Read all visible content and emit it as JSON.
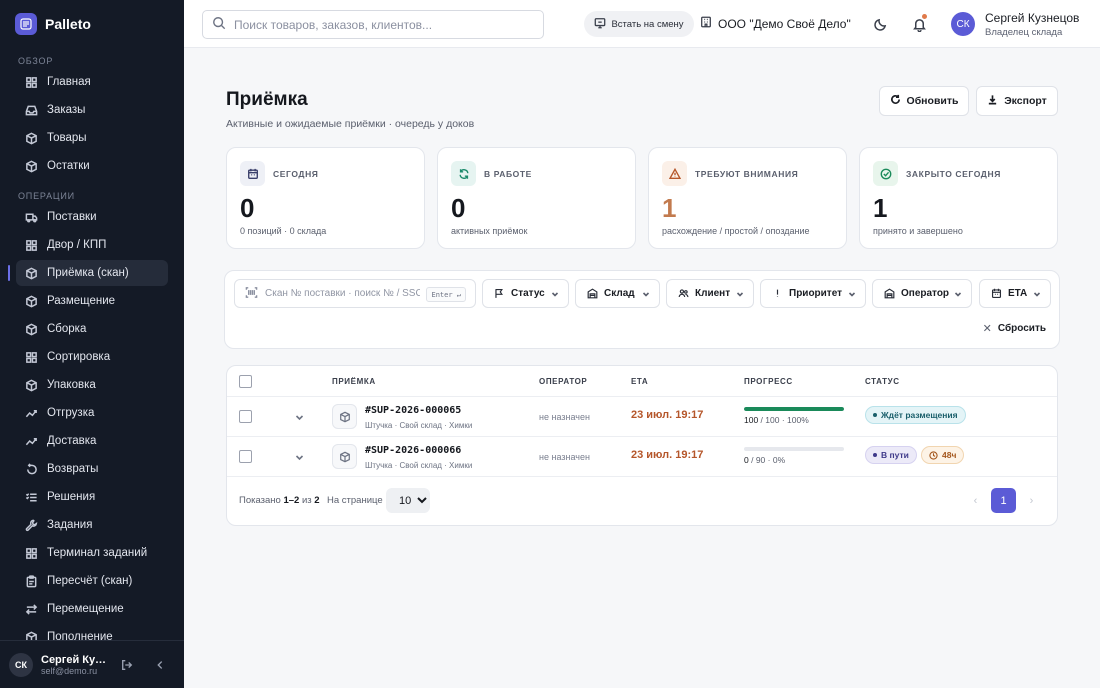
{
  "app": {
    "name": "Palleto"
  },
  "sidebar": {
    "sections": [
      {
        "title": "ОБЗОР",
        "items": [
          {
            "label": "Главная",
            "icon": "grid-icon"
          },
          {
            "label": "Заказы",
            "icon": "inbox-icon"
          },
          {
            "label": "Товары",
            "icon": "box-icon"
          },
          {
            "label": "Остатки",
            "icon": "box-icon"
          }
        ]
      },
      {
        "title": "ОПЕРАЦИИ",
        "items": [
          {
            "label": "Поставки",
            "icon": "truck-icon"
          },
          {
            "label": "Двор / КПП",
            "icon": "grid-icon"
          },
          {
            "label": "Приёмка (скан)",
            "icon": "box-icon",
            "active": true
          },
          {
            "label": "Размещение",
            "icon": "box-icon"
          },
          {
            "label": "Сборка",
            "icon": "box-icon"
          },
          {
            "label": "Сортировка",
            "icon": "grid-icon"
          },
          {
            "label": "Упаковка",
            "icon": "box-icon"
          },
          {
            "label": "Отгрузка",
            "icon": "trend-icon"
          },
          {
            "label": "Доставка",
            "icon": "trend-icon"
          },
          {
            "label": "Возвраты",
            "icon": "undo-icon"
          },
          {
            "label": "Решения",
            "icon": "list-check-icon"
          },
          {
            "label": "Задания",
            "icon": "wrench-icon"
          },
          {
            "label": "Терминал заданий",
            "icon": "grid-icon"
          },
          {
            "label": "Пересчёт (скан)",
            "icon": "clipboard-icon"
          },
          {
            "label": "Перемещение",
            "icon": "swap-icon"
          },
          {
            "label": "Пополнение",
            "icon": "box-icon"
          }
        ]
      }
    ],
    "user": {
      "initials": "СК",
      "name": "Сергей Кузнецов",
      "email": "self@demo.ru"
    }
  },
  "topbar": {
    "search_placeholder": "Поиск товаров, заказов, клиентов...",
    "shift_label": "Встать на смену",
    "org": "ООО \"Демо Своё Дело\"",
    "user": {
      "initials": "СК",
      "name": "Сергей Кузнецов",
      "role": "Владелец склада"
    }
  },
  "page": {
    "title": "Приёмка",
    "subtitle": "Активные и ожидаемые приёмки · очередь у доков",
    "refresh_label": "Обновить",
    "export_label": "Экспорт"
  },
  "cards": [
    {
      "label": "СЕГОДНЯ",
      "value": "0",
      "sub": "0 позиций · 0 склада",
      "icon": "calendar-icon",
      "icon_bg": "#eef0f6",
      "icon_color": "#3a3f6b",
      "value_color": "#15181e"
    },
    {
      "label": "В РАБОТЕ",
      "value": "0",
      "sub": "активных приёмок",
      "icon": "refresh-icon",
      "icon_bg": "#e6f4f1",
      "icon_color": "#1a8a6a",
      "value_color": "#15181e"
    },
    {
      "label": "ТРЕБУЮТ ВНИМАНИЯ",
      "value": "1",
      "sub": "расхождение / простой / опоздание",
      "icon": "warning-icon",
      "icon_bg": "#fbf0e8",
      "icon_color": "#b5562a",
      "value_color": "#c27a4e"
    },
    {
      "label": "ЗАКРЫТО СЕГОДНЯ",
      "value": "1",
      "sub": "принято и завершено",
      "icon": "check-circle-icon",
      "icon_bg": "#e8f5ec",
      "icon_color": "#1a8a5a",
      "value_color": "#15181e"
    }
  ],
  "filters": {
    "scan_placeholder": "Скан № поставки · поиск № / SSCC",
    "enter_key": "Enter ↵",
    "buttons": [
      {
        "label": "Статус",
        "icon": "flag-icon"
      },
      {
        "label": "Склад",
        "icon": "warehouse-icon"
      },
      {
        "label": "Клиент",
        "icon": "users-icon"
      },
      {
        "label": "Приоритет",
        "icon": "exclamation-icon"
      },
      {
        "label": "Оператор",
        "icon": "warehouse-icon"
      },
      {
        "label": "ETA",
        "icon": "calendar-icon"
      }
    ],
    "reset_label": "Сбросить"
  },
  "table": {
    "headers": [
      "ПРИЁМКА",
      "ОПЕРАТОР",
      "ETA",
      "ПРОГРЕСС",
      "СТАТУС"
    ],
    "rows": [
      {
        "id": "#SUP-2026-000065",
        "meta": "Штучка · Свой склад · Химки",
        "operator": "не назначен",
        "eta": "23 июл. 19:17",
        "done": "100",
        "total": "100",
        "pct": "100%",
        "progress": 1.0,
        "status": "Ждёт размещения",
        "status_bg": "#e4f4f7",
        "status_fg": "#1a5f6b",
        "status_border": "#b9e2ea"
      },
      {
        "id": "#SUP-2026-000066",
        "meta": "Штучка · Свой склад · Химки",
        "operator": "не назначен",
        "eta": "23 июл. 19:17",
        "done": "0",
        "total": "90",
        "pct": "0%",
        "progress": 0.0,
        "status": "В пути",
        "status_bg": "#eceaf8",
        "status_fg": "#3f3a8a",
        "status_border": "#d6d2f0",
        "extra_badge": "48ч"
      }
    ],
    "footer": {
      "shown_prefix": "Показано",
      "range": "1–2",
      "of": "из",
      "total": "2",
      "per_page_label": "На странице",
      "per_page": "10",
      "current_page": "1"
    }
  }
}
